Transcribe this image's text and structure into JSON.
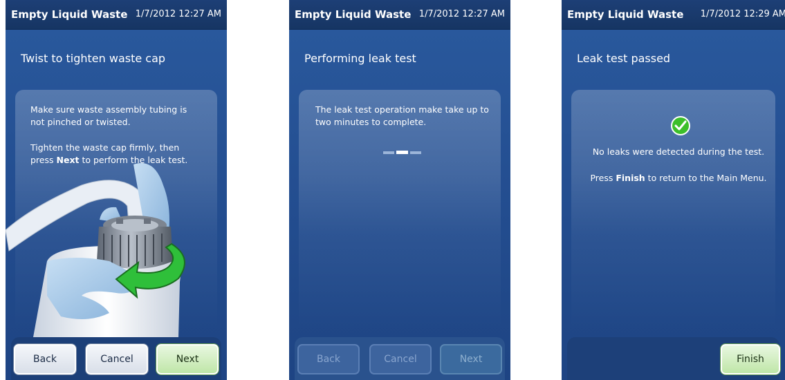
{
  "screens": [
    {
      "title": "Empty Liquid Waste",
      "datetime": "1/7/2012 12:27 AM",
      "heading": "Twist to tighten waste cap",
      "instructions": {
        "line1": "Make sure waste assembly tubing is not pinched or twisted.",
        "line2_pre": "Tighten the waste cap firmly, then press ",
        "line2_bold": "Next",
        "line2_post": " to perform the leak test."
      },
      "illustration_icon": "gloved-hands-tightening-cap-illustration",
      "buttons": {
        "back": "Back",
        "cancel": "Cancel",
        "next": "Next"
      }
    },
    {
      "title": "Empty Liquid Waste",
      "datetime": "1/7/2012 12:27 AM",
      "heading": "Performing leak test",
      "message": "The leak test operation make take up to two minutes to complete.",
      "progress_icon": "busy-dots-indicator",
      "buttons": {
        "back": "Back",
        "cancel": "Cancel",
        "next": "Next"
      }
    },
    {
      "title": "Empty Liquid Waste",
      "datetime": "1/7/2012 12:29 AM",
      "heading": "Leak test passed",
      "success_icon": "check-circle-icon",
      "message1": "No leaks were detected during the test.",
      "message2_pre": "Press ",
      "message2_bold": "Finish",
      "message2_post": " to return to the Main Menu.",
      "buttons": {
        "finish": "Finish"
      }
    }
  ],
  "colors": {
    "screen_bg": "#244f92",
    "titlebar_bg": "#163563",
    "success_green": "#3cbf2a",
    "arrow_green": "#2fbf3a",
    "glove_blue": "#9fc4e6"
  }
}
